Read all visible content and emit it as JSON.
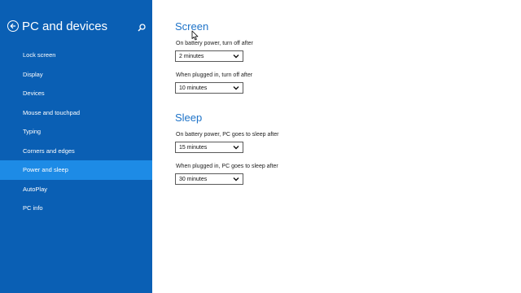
{
  "sidebar": {
    "title": "PC and devices",
    "back_icon": "back-arrow-circle-icon",
    "search_icon": "search-icon",
    "items": [
      {
        "label": "Lock screen"
      },
      {
        "label": "Display"
      },
      {
        "label": "Devices"
      },
      {
        "label": "Mouse and touchpad"
      },
      {
        "label": "Typing"
      },
      {
        "label": "Corners and edges"
      },
      {
        "label": "Power and sleep",
        "selected": true
      },
      {
        "label": "AutoPlay"
      },
      {
        "label": "PC info"
      }
    ]
  },
  "screen": {
    "title": "Screen",
    "battery_label": "On battery power, turn off after",
    "battery_value": "2 minutes",
    "plugged_label": "When plugged in, turn off after",
    "plugged_value": "10 minutes"
  },
  "sleep": {
    "title": "Sleep",
    "battery_label": "On battery power, PC goes to sleep after",
    "battery_value": "15 minutes",
    "plugged_label": "When plugged in, PC goes to sleep after",
    "plugged_value": "30 minutes"
  },
  "colors": {
    "sidebar_bg": "#0a5fb4",
    "selected_bg": "#1d8be6",
    "heading": "#1e73c8"
  }
}
